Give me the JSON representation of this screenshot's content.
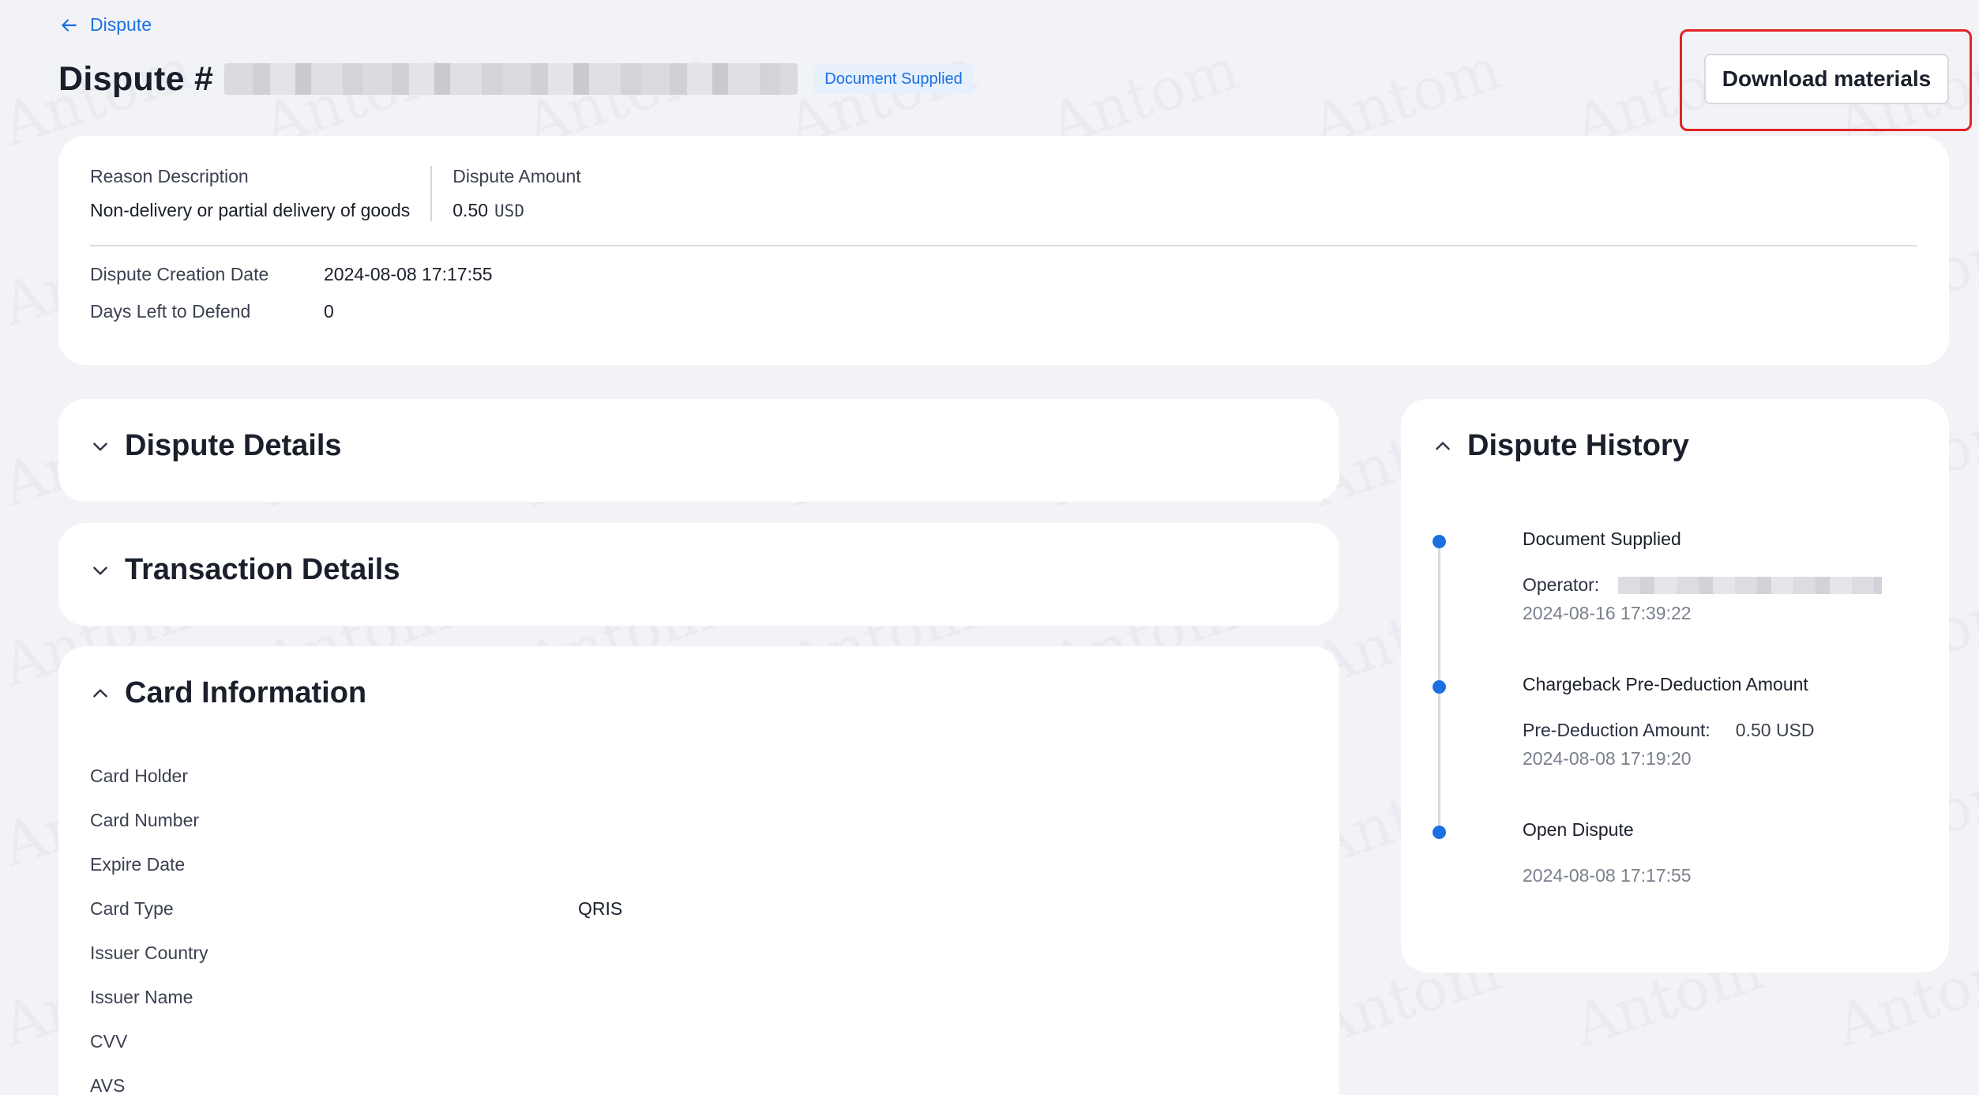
{
  "header": {
    "back_label": "Dispute",
    "title": "Dispute #",
    "status_badge": "Document Supplied",
    "download_label": "Download materials"
  },
  "summary": {
    "reason_label": "Reason Description",
    "reason_value": "Non-delivery or partial delivery of goods",
    "amount_label": "Dispute Amount",
    "amount_value": "0.50",
    "amount_currency": "USD",
    "creation_date_label": "Dispute Creation Date",
    "creation_date_value": "2024-08-08 17:17:55",
    "days_left_label": "Days Left to Defend",
    "days_left_value": "0"
  },
  "sections": {
    "dispute_details": "Dispute Details",
    "transaction_details": "Transaction Details",
    "card_information": "Card Information"
  },
  "card_info": [
    {
      "label": "Card Holder",
      "value": ""
    },
    {
      "label": "Card Number",
      "value": ""
    },
    {
      "label": "Expire Date",
      "value": ""
    },
    {
      "label": "Card Type",
      "value": "QRIS"
    },
    {
      "label": "Issuer Country",
      "value": ""
    },
    {
      "label": "Issuer Name",
      "value": ""
    },
    {
      "label": "CVV",
      "value": ""
    },
    {
      "label": "AVS",
      "value": ""
    }
  ],
  "history": {
    "title": "Dispute History",
    "items": [
      {
        "title": "Document Supplied",
        "key": "Operator:",
        "value": "",
        "time": "2024-08-16 17:39:22"
      },
      {
        "title": "Chargeback Pre-Deduction Amount",
        "key": "Pre-Deduction Amount:",
        "value": "0.50 USD",
        "time": "2024-08-08 17:19:20"
      },
      {
        "title": "Open Dispute",
        "key": "",
        "value": "",
        "time": "2024-08-08 17:17:55"
      }
    ]
  },
  "watermark_text": "Antom",
  "colors": {
    "accent": "#1b6fe0",
    "highlight_outline": "#e02424",
    "background": "#f2f3f7",
    "card": "#ffffff"
  }
}
